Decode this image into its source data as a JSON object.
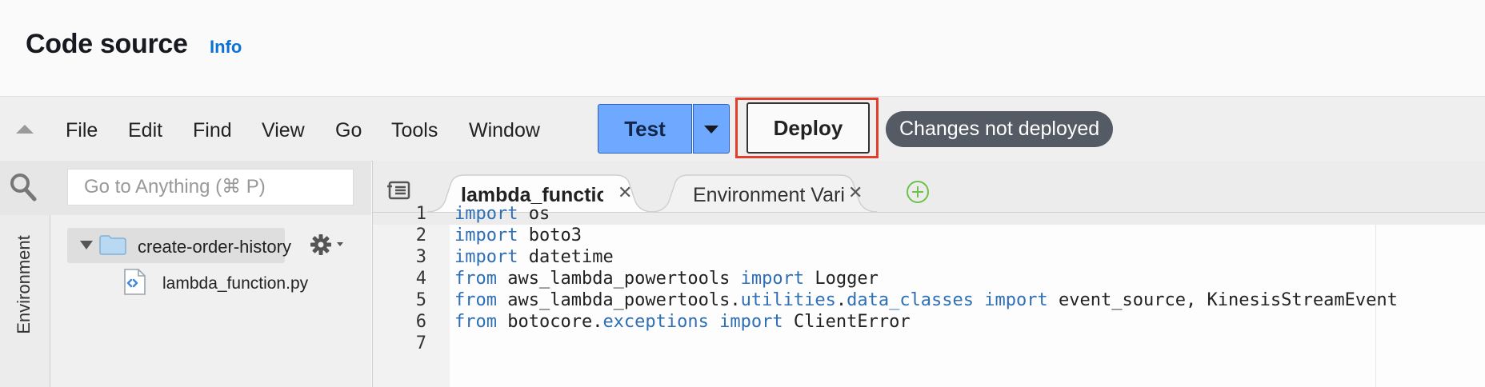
{
  "header": {
    "title": "Code source",
    "info_label": "Info"
  },
  "menu": {
    "items": [
      "File",
      "Edit",
      "Find",
      "View",
      "Go",
      "Tools",
      "Window"
    ]
  },
  "actions": {
    "test_label": "Test",
    "deploy_label": "Deploy",
    "status_badge": "Changes not deployed",
    "highlight_color": "#e23e2b",
    "test_color": "#6ea9ff"
  },
  "sidebar": {
    "search_placeholder": "Go to Anything (⌘ P)",
    "environment_label": "Environment",
    "folder": {
      "name": "create-order-history",
      "icon": "folder-icon",
      "expanded": true
    },
    "files": [
      {
        "name": "lambda_function.py",
        "icon": "python-file-icon"
      }
    ]
  },
  "editor": {
    "tabs": [
      {
        "label": "lambda_function",
        "active": true
      },
      {
        "label": "Environment Vari",
        "active": false
      }
    ],
    "lines": [
      {
        "num": "1",
        "tokens": [
          {
            "t": "import",
            "k": true
          },
          {
            "t": " os"
          }
        ]
      },
      {
        "num": "2",
        "tokens": [
          {
            "t": "import",
            "k": true
          },
          {
            "t": " boto3"
          }
        ]
      },
      {
        "num": "3",
        "tokens": [
          {
            "t": "import",
            "k": true
          },
          {
            "t": " datetime"
          }
        ]
      },
      {
        "num": "4",
        "tokens": [
          {
            "t": "from",
            "k": true
          },
          {
            "t": " aws_lambda_powertools "
          },
          {
            "t": "import",
            "k": true
          },
          {
            "t": " Logger"
          }
        ]
      },
      {
        "num": "5",
        "tokens": [
          {
            "t": "from",
            "k": true
          },
          {
            "t": " aws_lambda_powertools."
          },
          {
            "t": "utilities",
            "k": true
          },
          {
            "t": "."
          },
          {
            "t": "data_classes",
            "k": true
          },
          {
            "t": " "
          },
          {
            "t": "import",
            "k": true
          },
          {
            "t": " event_source, KinesisStreamEvent"
          }
        ]
      },
      {
        "num": "6",
        "tokens": [
          {
            "t": "from",
            "k": true
          },
          {
            "t": " botocore."
          },
          {
            "t": "exceptions",
            "k": true
          },
          {
            "t": " "
          },
          {
            "t": "import",
            "k": true
          },
          {
            "t": " ClientError"
          }
        ]
      },
      {
        "num": "7",
        "tokens": []
      }
    ]
  }
}
